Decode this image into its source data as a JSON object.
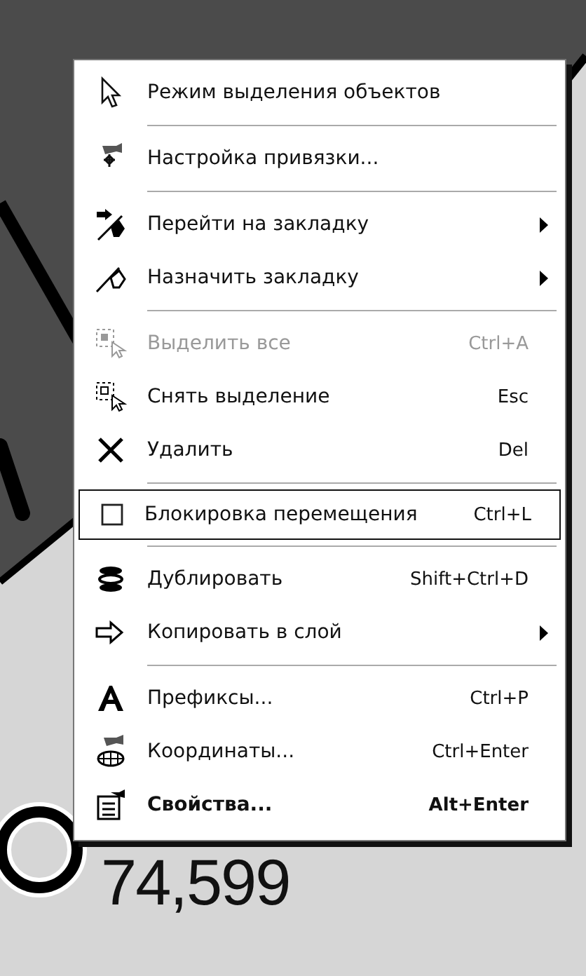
{
  "canvas": {
    "label": "74,599"
  },
  "context_menu": {
    "items": [
      {
        "kind": "item",
        "label": "Режим выделения объектов",
        "disabled": false,
        "submenu": false,
        "bold": false
      },
      {
        "kind": "separator"
      },
      {
        "kind": "item",
        "label": "Настройка привязки...",
        "disabled": false,
        "submenu": false,
        "bold": false
      },
      {
        "kind": "separator"
      },
      {
        "kind": "item",
        "label": "Перейти на закладку",
        "disabled": false,
        "submenu": true,
        "bold": false
      },
      {
        "kind": "item",
        "label": "Назначить закладку",
        "disabled": false,
        "submenu": true,
        "bold": false
      },
      {
        "kind": "separator"
      },
      {
        "kind": "item",
        "label": "Выделить все",
        "shortcut": "Ctrl+A",
        "disabled": true,
        "submenu": false,
        "bold": false
      },
      {
        "kind": "item",
        "label": "Снять выделение",
        "shortcut": "Esc",
        "disabled": false,
        "submenu": false,
        "bold": false
      },
      {
        "kind": "item",
        "label": "Удалить",
        "shortcut": "Del",
        "disabled": false,
        "submenu": false,
        "bold": false
      },
      {
        "kind": "separator"
      },
      {
        "kind": "checkbox",
        "label": "Блокировка перемещения",
        "shortcut": "Ctrl+L",
        "checked": false,
        "selected": true
      },
      {
        "kind": "separator"
      },
      {
        "kind": "item",
        "label": "Дублировать",
        "shortcut": "Shift+Ctrl+D",
        "disabled": false,
        "submenu": false,
        "bold": false
      },
      {
        "kind": "item",
        "label": "Копировать в слой",
        "disabled": false,
        "submenu": true,
        "bold": false
      },
      {
        "kind": "separator"
      },
      {
        "kind": "item",
        "label": "Префиксы...",
        "shortcut": "Ctrl+P",
        "disabled": false,
        "submenu": false,
        "bold": false
      },
      {
        "kind": "item",
        "label": "Координаты...",
        "shortcut": "Ctrl+Enter",
        "disabled": false,
        "submenu": false,
        "bold": false
      },
      {
        "kind": "item",
        "label": "Свойства...",
        "shortcut": "Alt+Enter",
        "disabled": false,
        "submenu": false,
        "bold": true
      }
    ]
  }
}
